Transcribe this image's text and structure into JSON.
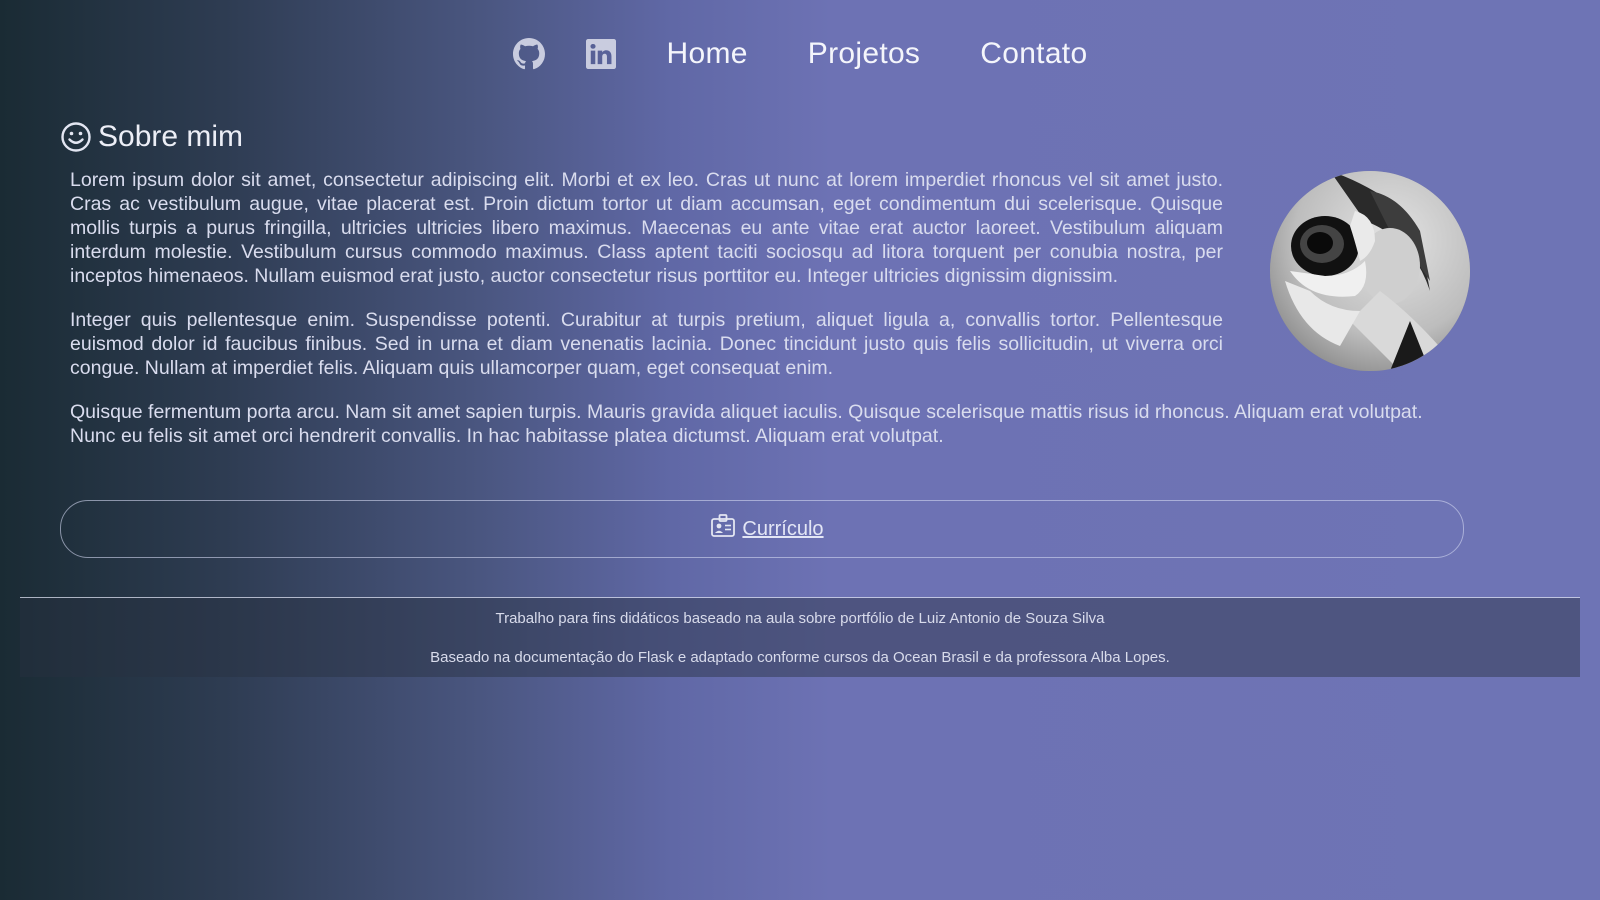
{
  "nav": {
    "github_icon": "github-icon",
    "linkedin_icon": "linkedin-icon",
    "links": [
      {
        "label": "Home"
      },
      {
        "label": "Projetos"
      },
      {
        "label": "Contato"
      }
    ]
  },
  "about": {
    "title": "Sobre mim",
    "title_icon": "smile-icon",
    "paragraphs": [
      "Lorem ipsum dolor sit amet, consectetur adipiscing elit. Morbi et ex leo. Cras ut nunc at lorem imperdiet rhoncus vel sit amet justo. Cras ac vestibulum augue, vitae placerat est. Proin dictum tortor ut diam accumsan, eget condimentum dui scelerisque. Quisque mollis turpis a purus fringilla, ultricies ultricies libero maximus. Maecenas eu ante vitae erat auctor laoreet. Vestibulum aliquam interdum molestie. Vestibulum cursus commodo maximus. Class aptent taciti sociosqu ad litora torquent per conubia nostra, per inceptos himenaeos. Nullam euismod erat justo, auctor consectetur risus porttitor eu. Integer ultricies dignissim dignissim.",
      "Integer quis pellentesque enim. Suspendisse potenti. Curabitur at turpis pretium, aliquet ligula a, convallis tortor. Pellentesque euismod dolor id faucibus finibus. Sed in urna et diam venenatis lacinia. Donec tincidunt justo quis felis sollicitudin, ut viverra orci congue. Nullam at imperdiet felis. Aliquam quis ullamcorper quam, eget consequat enim.",
      "Quisque fermentum porta arcu. Nam sit amet sapien turpis. Mauris gravida aliquet iaculis. Quisque scelerisque mattis risus id rhoncus. Aliquam erat volutpat. Nunc eu felis sit amet orci hendrerit convallis. In hac habitasse platea dictumst. Aliquam erat volutpat."
    ]
  },
  "cv": {
    "label": "Currículo",
    "icon": "id-badge-icon"
  },
  "footer": {
    "line1": "Trabalho para fins didáticos baseado na aula sobre portfólio de Luiz Antonio de Souza Silva",
    "line2": "Baseado na documentação do Flask e adaptado conforme cursos da Ocean Brasil e da professora Alba Lopes."
  },
  "colors": {
    "gradient_start": "#1a2b34",
    "gradient_end": "#6e74b5",
    "text": "#e6e8f2"
  }
}
